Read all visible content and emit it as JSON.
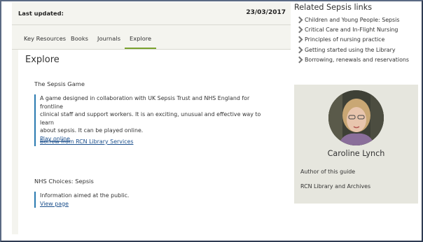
{
  "guide": {
    "last_updated_label": "Last updated:",
    "last_updated_date": "23/03/2017"
  },
  "tabs": [
    {
      "label": "Key Resources",
      "active": false
    },
    {
      "label": "Books",
      "active": false
    },
    {
      "label": "Journals",
      "active": false
    },
    {
      "label": "Explore",
      "active": true
    }
  ],
  "explore": {
    "title": "Explore",
    "sections": [
      {
        "title": "The Sepsis Game",
        "description_lines": [
          "A game designed in collaboration with UK Sepsis Trust and NHS England for frontline",
          "clinical staff and support workers. It is an exciting, unusual and effective way to learn",
          "about sepsis. It can be played online."
        ],
        "link": "Play online",
        "extra_link": "Borrow from RCN Library Services"
      },
      {
        "title": "NHS Choices: Sepsis",
        "description_lines": [
          "Information aimed at the public."
        ],
        "link": "View page"
      }
    ]
  },
  "related": {
    "title": "Related Sepsis links",
    "items": [
      "Children and Young People: Sepsis",
      "Critical Care and In-Flight Nursing",
      "Principles of nursing practice",
      "Getting started using the Library",
      "Borrowing, renewals and reservations"
    ],
    "icon": "chevron-right-icon"
  },
  "profile": {
    "name": "Caroline Lynch",
    "role": "Author of this guide",
    "department": "RCN Library and Archives"
  },
  "colors": {
    "accent": "#7aa22e",
    "link": "#1b4f8c",
    "quote_bar": "#2a7ab0",
    "panel_bg": "#f4f4ef",
    "profile_bg": "#e6e6de"
  }
}
